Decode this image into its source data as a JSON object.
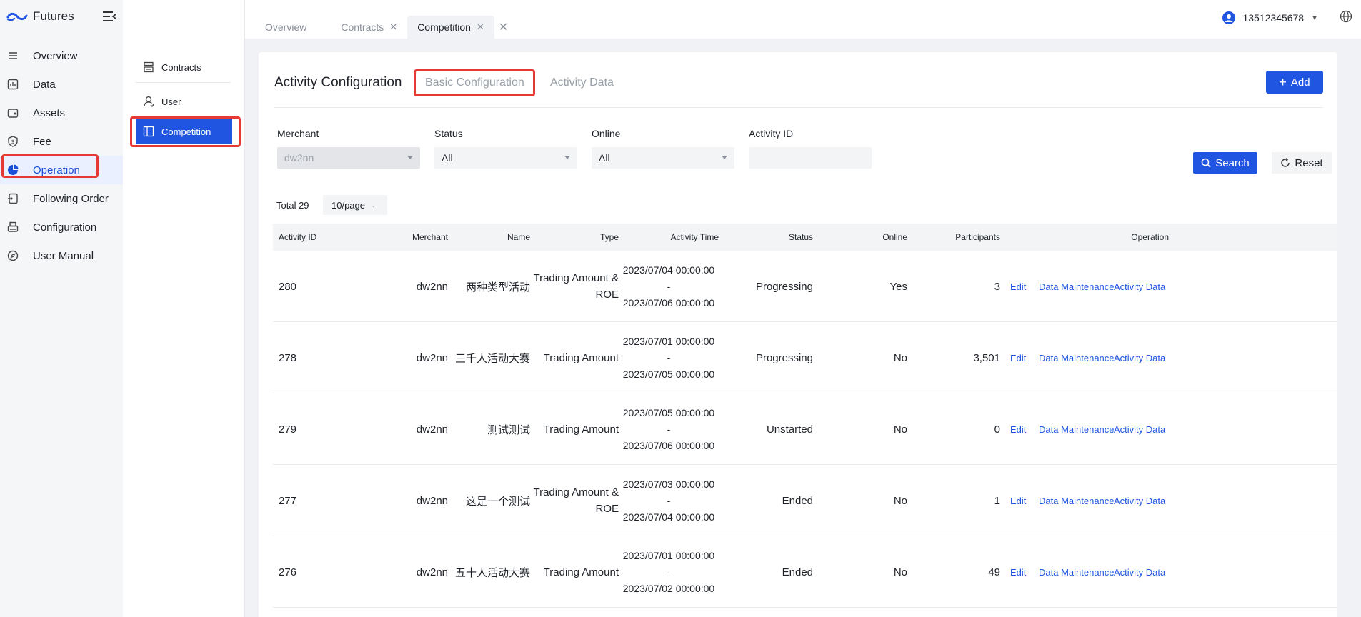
{
  "app": {
    "brand": "Futures"
  },
  "sidebar": {
    "items": [
      {
        "label": "Overview",
        "icon": "list-icon"
      },
      {
        "label": "Data",
        "icon": "chart-icon"
      },
      {
        "label": "Assets",
        "icon": "wallet-icon"
      },
      {
        "label": "Fee",
        "icon": "shield-dollar-icon"
      },
      {
        "label": "Operation",
        "icon": "pie-icon",
        "active": true
      },
      {
        "label": "Following Order",
        "icon": "follow-icon"
      },
      {
        "label": "Configuration",
        "icon": "printer-icon"
      },
      {
        "label": "User Manual",
        "icon": "compass-icon"
      }
    ]
  },
  "submenu": {
    "items": [
      {
        "label": "Contracts",
        "icon": "contracts-icon"
      },
      {
        "label": "User",
        "icon": "user-icon"
      },
      {
        "label": "Competition",
        "icon": "competition-icon",
        "active": true
      }
    ]
  },
  "header": {
    "tabs": [
      {
        "label": "Overview",
        "closable": false
      },
      {
        "label": "Contracts",
        "closable": true
      },
      {
        "label": "Competition",
        "closable": true,
        "active": true
      }
    ],
    "username": "13512345678"
  },
  "page": {
    "title": "Activity Configuration",
    "tabs": [
      "Basic Configuration",
      "Activity Data"
    ],
    "add_label": "Add"
  },
  "filters": {
    "merchant_label": "Merchant",
    "merchant_value": "dw2nn",
    "status_label": "Status",
    "status_value": "All",
    "online_label": "Online",
    "online_value": "All",
    "activity_id_label": "Activity ID",
    "activity_id_value": "",
    "search_label": "Search",
    "reset_label": "Reset"
  },
  "pagination": {
    "total": "Total 29",
    "page_size": "10/page"
  },
  "table": {
    "columns": [
      "Activity ID",
      "Merchant",
      "Name",
      "Type",
      "Activity Time",
      "Status",
      "Online",
      "Participants",
      "Operation"
    ],
    "ops": [
      "Edit",
      "Data Maintenance",
      "Activity Data"
    ],
    "rows": [
      {
        "id": "280",
        "merchant": "dw2nn",
        "name": "两种类型活动",
        "type1": "Trading Amount &",
        "type2": "ROE",
        "start": "2023/07/04 00:00:00",
        "sep": "-",
        "end": "2023/07/06 00:00:00",
        "status": "Progressing",
        "online": "Yes",
        "participants": "3"
      },
      {
        "id": "278",
        "merchant": "dw2nn",
        "name": "三千人活动大赛",
        "type1": "Trading Amount",
        "type2": "",
        "start": "2023/07/01 00:00:00",
        "sep": "-",
        "end": "2023/07/05 00:00:00",
        "status": "Progressing",
        "online": "No",
        "participants": "3,501"
      },
      {
        "id": "279",
        "merchant": "dw2nn",
        "name": "测试测试",
        "type1": "Trading Amount",
        "type2": "",
        "start": "2023/07/05 00:00:00",
        "sep": "-",
        "end": "2023/07/06 00:00:00",
        "status": "Unstarted",
        "online": "No",
        "participants": "0"
      },
      {
        "id": "277",
        "merchant": "dw2nn",
        "name": "这是一个测试",
        "type1": "Trading Amount &",
        "type2": "ROE",
        "start": "2023/07/03 00:00:00",
        "sep": "-",
        "end": "2023/07/04 00:00:00",
        "status": "Ended",
        "online": "No",
        "participants": "1"
      },
      {
        "id": "276",
        "merchant": "dw2nn",
        "name": "五十人活动大赛",
        "type1": "Trading Amount",
        "type2": "",
        "start": "2023/07/01 00:00:00",
        "sep": "-",
        "end": "2023/07/02 00:00:00",
        "status": "Ended",
        "online": "No",
        "participants": "49"
      }
    ]
  },
  "colors": {
    "primary": "#1f55e0",
    "highlight": "#e53935"
  }
}
